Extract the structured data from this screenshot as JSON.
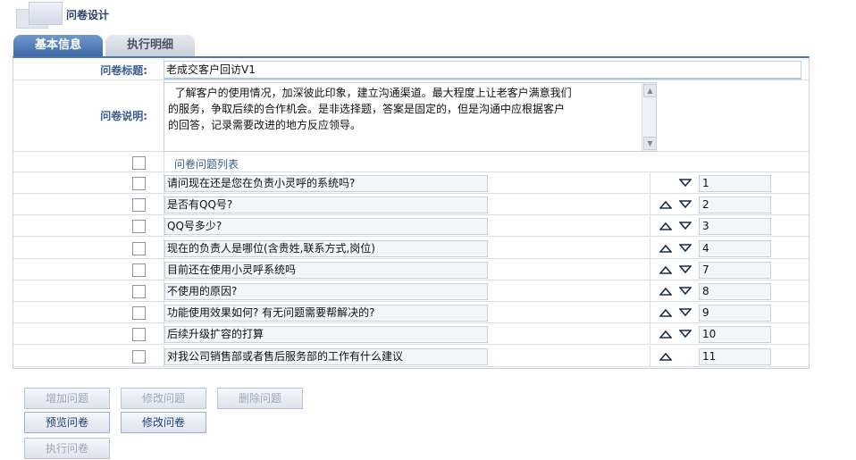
{
  "header": {
    "title": "问卷设计"
  },
  "tabs": [
    {
      "label": "基本信息",
      "active": true
    },
    {
      "label": "执行明细",
      "active": false
    }
  ],
  "form": {
    "title_label": "问卷标题:",
    "title_value": "老成交客户回访V1",
    "desc_label": "问卷说明:",
    "desc_value": "  了解客户的使用情况，加深彼此印象，建立沟通渠道。最大程度上让老客户满意我们\n的服务，争取后续的合作机会。是非选择题，答案是固定的，但是沟通中应根据客户\n的回答，记录需要改进的地方反应领导。",
    "list_header": "问卷问题列表"
  },
  "questions": [
    {
      "text": "请问现在还是您在负责小灵呼的系统吗?",
      "order": "1",
      "up": false,
      "down": true
    },
    {
      "text": "是否有QQ号?",
      "order": "2",
      "up": true,
      "down": true
    },
    {
      "text": "QQ号多少?",
      "order": "3",
      "up": true,
      "down": true
    },
    {
      "text": "现在的负责人是哪位(含贵姓,联系方式,岗位)",
      "order": "4",
      "up": true,
      "down": true
    },
    {
      "text": "目前还在使用小灵呼系统吗",
      "order": "7",
      "up": true,
      "down": true
    },
    {
      "text": "不使用的原因?",
      "order": "8",
      "up": true,
      "down": true
    },
    {
      "text": "功能使用效果如何? 有无问题需要帮解决的?",
      "order": "9",
      "up": true,
      "down": true
    },
    {
      "text": "后续升级扩容的打算",
      "order": "10",
      "up": true,
      "down": true
    },
    {
      "text": "对我公司销售部或者售后服务部的工作有什么建议",
      "order": "11",
      "up": true,
      "down": false
    }
  ],
  "buttons": {
    "add": {
      "label": "增加问题",
      "enabled": false
    },
    "modify_q": {
      "label": "修改问题",
      "enabled": false
    },
    "delete": {
      "label": "删除问题",
      "enabled": false
    },
    "preview": {
      "label": "预览问卷",
      "enabled": true
    },
    "modify_s": {
      "label": "修改问卷",
      "enabled": true
    },
    "execute": {
      "label": "执行问卷",
      "enabled": false
    }
  },
  "colors": {
    "accent": "#4d77b2",
    "label": "#3a5d8f",
    "arrow": "#1e2b45"
  }
}
